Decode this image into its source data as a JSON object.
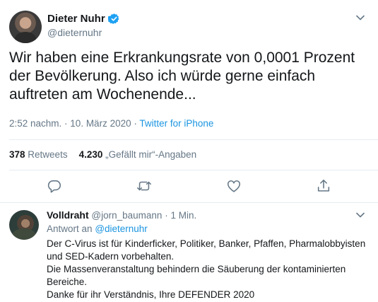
{
  "main_tweet": {
    "display_name": "Dieter Nuhr",
    "handle": "@dieternuhr",
    "text": "Wir haben eine Erkrankungsrate von 0,0001 Prozent der Bevölkerung. Also ich würde gerne einfach auftreten am Wochenende...",
    "time": "2:52 nachm.",
    "separator": " · ",
    "date": "10. März 2020",
    "source": "Twitter for iPhone",
    "retweets_count": "378",
    "retweets_label": "Retweets",
    "likes_count": "4.230",
    "likes_label": "„Gefällt mir“-Angaben",
    "icons": {
      "verified": "verified-badge-icon",
      "caret": "chevron-down-icon",
      "reply": "reply-icon",
      "retweet": "retweet-icon",
      "like": "heart-icon",
      "share": "share-icon"
    }
  },
  "reply": {
    "display_name": "Volldraht",
    "handle": "@jorn_baumann",
    "separator": " · ",
    "time": "1 Min.",
    "reply_to_label": "Antwort an",
    "reply_to_handle": "@dieternuhr",
    "lines": [
      "Der C-Virus ist für Kinderficker, Politiker, Banker, Pfaffen, Pharmalobbyisten",
      "und SED-Kadern vorbehalten.",
      "Die Massenveranstaltung behindern die Säuberung der kontaminierten",
      "Bereiche.",
      "Danke für ihr Verständnis, Ihre DEFENDER 2020"
    ]
  },
  "colors": {
    "accent": "#1b95e0",
    "verified": "#1da1f2",
    "muted": "#657786",
    "text": "#14171a",
    "divider": "#e6ecf0"
  }
}
